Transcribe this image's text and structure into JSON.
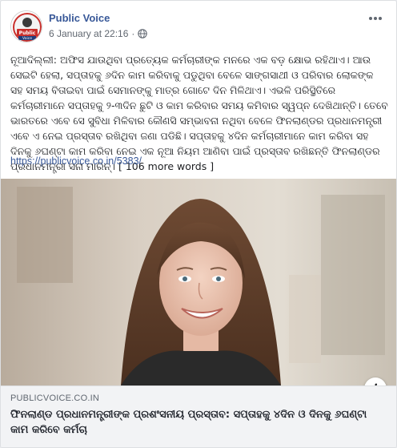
{
  "post": {
    "page_name": "Public Voice",
    "avatar_text": "Public Voice",
    "date": "6 January at 22:16",
    "separator": "·",
    "privacy_icon": "globe-icon",
    "options_icon": "more-options-icon",
    "message": "ନୂଆଦିଲ୍ଲୀ: ଅଫିସ ଯାଉଥିବା ପ୍ରତ୍ୟେକ କର୍ମଚାରୀଙ୍କ ମନରେ ଏକ ବଡ଼ କ୍ଷୋଭ ରହିଥାଏ। ଆଉ ସେଇଟି ହେଲା, ସପ୍ତାହକୁ ୬ଦିନ କାମ କରିବାକୁ ପଡୁଥିବା ବେଳେ ସାଙ୍ଗସାଥୀ ଓ ପରିବାର ଲୋକଙ୍କ ସହ ସମୟ ବିତାଇବା ପାଇଁ ସେମାନଙ୍କୁ ମାତ୍ର ଗୋଟେ ଦିନ ମିଳିଥାଏ। ଏଭଳି ପରିସ୍ଥିତିରେ କର୍ମଚାରୀମାନେ ସପ୍ତାହକୁ ୨-୩ଦିନ ଛୁଟି ଓ କାମ କରିବାର ସମୟ କମିବାର ସ୍ୱପ୍ନ ଦେଖିଥାନ୍ତି। ତେବେ ଭାରତରେ ଏବେ ସେ ସୁବିଧା ମିଳିବାର କୌଣସି ସମ୍ଭାବନା ନଥିବା ବେଳେ ଫିନଲାଣ୍ଡର ପ୍ରଧାନମନ୍ତ୍ରୀ ଏବେ ଏ ନେଇ ପ୍ରସ୍ତାବ ରଖିଥିବା ଜଣା ପଡିଛି। ସପ୍ତାହକୁ ୪ଦିନ କର୍ମଚାରୀମାନେ କାମ କରିବା ସହ ଦିନକୁ ୬ଘଣ୍ଟା କାମ କରିବା ନେଇ ଏକ ନୂଆ ନିୟମ ଆଣିବା ପାଇଁ ପ୍ରସ୍ତାବ ରଖିଛନ୍ତି ଫିନଲାଣ୍ଡର ପ୍ରଧାନମନ୍ତ୍ରୀ ସନା ମାରିନ୍।",
    "more_words": "[ 106 more words ]",
    "link_url": "https://publicvoice.co.in/5383/"
  },
  "preview": {
    "domain": "PUBLICVOICE.CO.IN",
    "headline": "ଫିନଲାଣ୍ଡ ପ୍ରଧାନମନ୍ତ୍ରୀଙ୍କ ପ୍ରଶଂସନୀୟ ପ୍ରସ୍ତାବ: ସପ୍ତାହକୁ ୪ଦିନ ଓ ଦିନକୁ ୬ଘଣ୍ଟା କାମ କରିବେ କର୍ମଚା",
    "info_label": "i"
  },
  "colors": {
    "link": "#385898",
    "meta": "#606770",
    "preview_bg": "#f2f3f5"
  }
}
